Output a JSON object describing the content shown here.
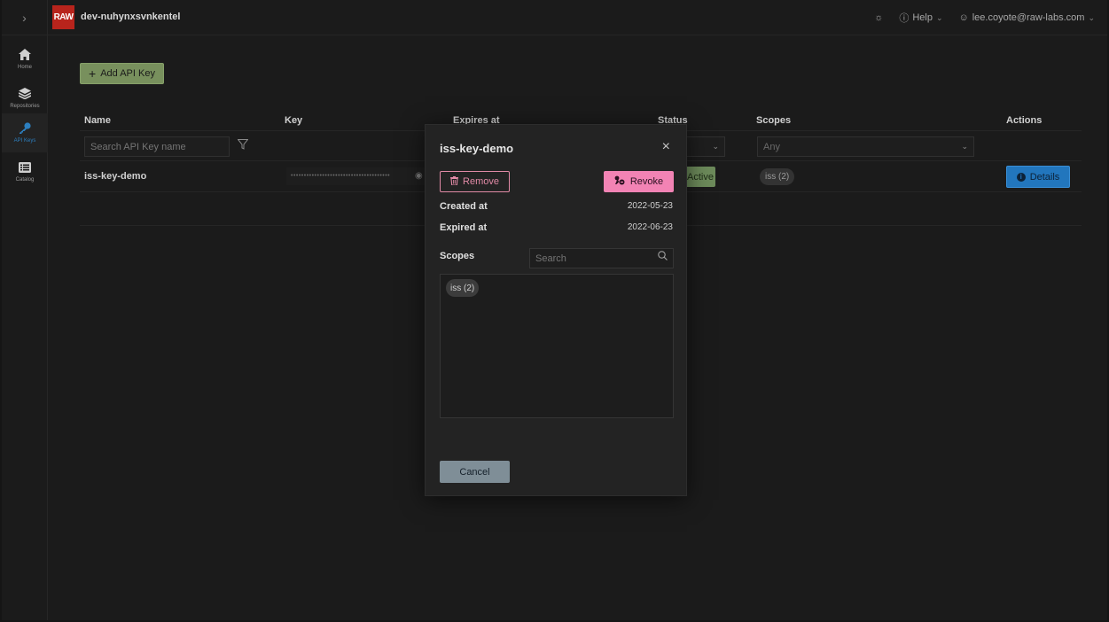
{
  "topbar": {
    "expand_icon": "chevron-right-icon",
    "logo_text": "RAW",
    "workspace": "dev-nuhynxsvnkentel",
    "theme_icon": "sun-icon",
    "help_label": "Help",
    "user_email": "lee.coyote@raw-labs.com"
  },
  "sidebar": {
    "items": [
      {
        "label": "Home",
        "icon": "home-icon"
      },
      {
        "label": "Repositories",
        "icon": "layers-icon"
      },
      {
        "label": "API Keys",
        "icon": "key-icon",
        "active": true
      },
      {
        "label": "Catalog",
        "icon": "list-icon"
      }
    ]
  },
  "main": {
    "add_button": "Add API Key",
    "columns": [
      "Name",
      "Key",
      "Expires at",
      "Status",
      "Scopes",
      "Actions"
    ],
    "filters": {
      "name_placeholder": "Search API Key name",
      "scopes_value": "Any"
    },
    "rows": [
      {
        "name": "iss-key-demo",
        "key_masked": "••••••••••••••••••••••••••••••••••••••",
        "status": "Active",
        "scope": "iss (2)",
        "action": "Details"
      }
    ]
  },
  "dialog": {
    "title": "iss-key-demo",
    "remove_label": "Remove",
    "revoke_label": "Revoke",
    "created_label": "Created at",
    "created_value": "2022-05-23",
    "expired_label": "Expired at",
    "expired_value": "2022-06-23",
    "scopes_label": "Scopes",
    "search_placeholder": "Search",
    "scope_chips": [
      "iss (2)"
    ],
    "cancel_label": "Cancel"
  },
  "colors": {
    "accent_blue": "#2276bd",
    "add_green": "#78905d",
    "revoke_pink": "#f283b4",
    "remove_outline": "#e18aa6",
    "logo_red": "#b8241c"
  }
}
